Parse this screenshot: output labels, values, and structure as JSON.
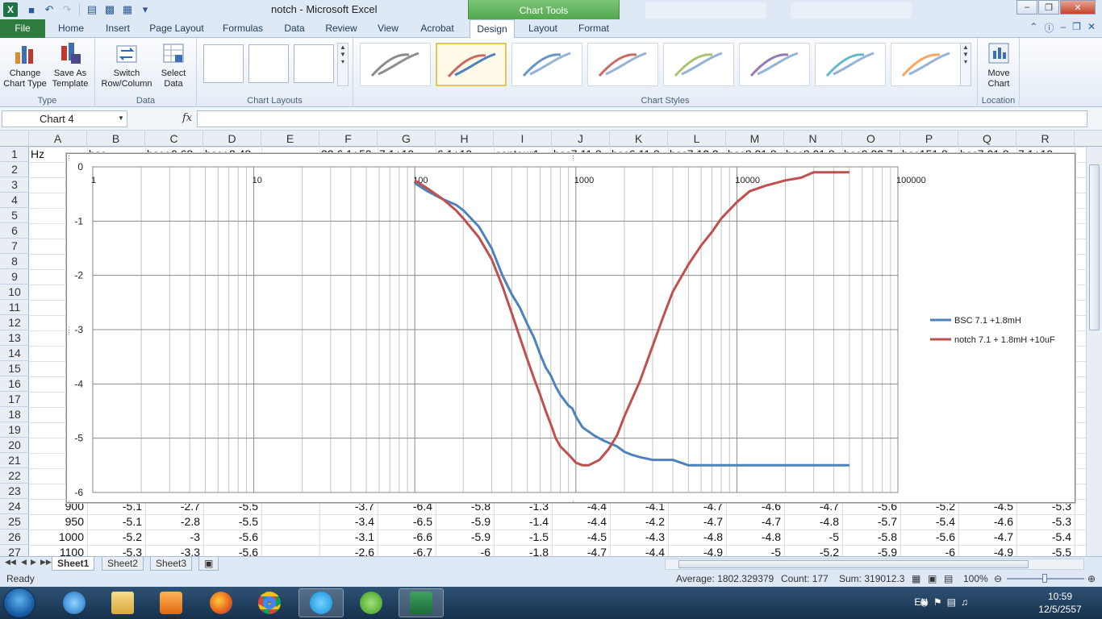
{
  "window": {
    "title": "notch  -  Microsoft Excel",
    "chart_tools_label": "Chart Tools"
  },
  "ribbon": {
    "tabs": [
      "Home",
      "Insert",
      "Page Layout",
      "Formulas",
      "Data",
      "Review",
      "View",
      "Acrobat",
      "Design",
      "Layout",
      "Format"
    ],
    "file_tab": "File",
    "active_tab": "Design",
    "groups": {
      "type": {
        "label": "Type",
        "change_chart_type": "Change Chart Type",
        "save_as_template": "Save As Template"
      },
      "data": {
        "label": "Data",
        "switch_row_column": "Switch Row/Column",
        "select_data": "Select Data"
      },
      "chart_layouts": {
        "label": "Chart Layouts"
      },
      "chart_styles": {
        "label": "Chart Styles",
        "style_colors": [
          "#555555",
          "#c0504d",
          "#4f81bd",
          "#c0504d",
          "#9bbb59",
          "#8064a2",
          "#4bacc6",
          "#f79646"
        ],
        "selected_index": 1
      },
      "location": {
        "label": "Location",
        "move_chart": "Move Chart"
      }
    }
  },
  "formula_bar": {
    "name_box": "Chart 4",
    "fx": "fx",
    "formula": ""
  },
  "columns": [
    "A",
    "B",
    "C",
    "D",
    "E",
    "F",
    "G",
    "H",
    "I",
    "J",
    "K",
    "L",
    "M",
    "N",
    "O",
    "P",
    "Q",
    "R"
  ],
  "rows": [
    "1",
    "2",
    "3",
    "4",
    "5",
    "6",
    "7",
    "8",
    "9",
    "10",
    "11",
    "12",
    "13",
    "14",
    "15",
    "16",
    "17",
    "18",
    "19",
    "20",
    "21",
    "22",
    "23",
    "24",
    "25",
    "26",
    "27"
  ],
  "cells": {
    "a1": "Hz",
    "row24": [
      "900",
      "-5.1",
      "-2.7",
      "-5.5",
      "",
      "-3.7",
      "-6.4",
      "-5.8",
      "-1.3",
      "-4.4",
      "-4.1",
      "-4.7",
      "-4.6",
      "-4.7",
      "-5.6",
      "-5.2",
      "-4.5",
      "-5.3"
    ],
    "row25": [
      "950",
      "-5.1",
      "-2.8",
      "-5.5",
      "",
      "-3.4",
      "-6.5",
      "-5.9",
      "-1.4",
      "-4.4",
      "-4.2",
      "-4.7",
      "-4.7",
      "-4.8",
      "-5.7",
      "-5.4",
      "-4.6",
      "-5.3"
    ],
    "row26": [
      "1000",
      "-5.2",
      "-3",
      "-5.6",
      "",
      "-3.1",
      "-6.6",
      "-5.9",
      "-1.5",
      "-4.5",
      "-4.3",
      "-4.8",
      "-4.8",
      "-5",
      "-5.8",
      "-5.6",
      "-4.7",
      "-5.4"
    ],
    "row27": [
      "1100",
      "-5.3",
      "-3.3",
      "-5.6",
      "",
      "-2.6",
      "-6.7",
      "-6",
      "-1.8",
      "-4.7",
      "-4.4",
      "-4.9",
      "-5",
      "-5.2",
      "-5.9",
      "-6",
      "-4.9",
      "-5.5"
    ],
    "row1_partial": [
      "bsc",
      "bsc+0.68",
      "bsc+2.48",
      "",
      "22.6.1+50",
      "7.1+10",
      "6.1+10",
      "contour1",
      "bsc7.11.8",
      "bsc6.11.8",
      "bsc7.12.2",
      "bsc8.21.8",
      "bsc8.01.8",
      "bsc9.22.7",
      "bsc151.8",
      "bsc7.01.8",
      "7.1+10"
    ]
  },
  "sheets": [
    "Sheet1",
    "Sheet2",
    "Sheet3"
  ],
  "active_sheet": "Sheet1",
  "status": {
    "ready": "Ready",
    "average": "Average: 1802.329379",
    "count": "Count: 177",
    "sum": "Sum: 319012.3",
    "zoom": "100%"
  },
  "taskbar": {
    "lang": "EN",
    "time": "10:59",
    "date": "12/5/2557"
  },
  "chart_data": {
    "type": "line",
    "xscale": "log",
    "xlim": [
      1,
      100000
    ],
    "ylim": [
      -6,
      0
    ],
    "x_ticks": [
      "1",
      "10",
      "100",
      "1000",
      "10000",
      "100000"
    ],
    "y_ticks": [
      "0",
      "-1",
      "-2",
      "-3",
      "-4",
      "-5",
      "-6"
    ],
    "legend_position": "right",
    "grid": true,
    "series": [
      {
        "name": "BSC 7.1 +1.8mH",
        "color": "#4f81bd",
        "x": [
          100,
          120,
          150,
          180,
          200,
          250,
          300,
          350,
          400,
          450,
          500,
          550,
          600,
          650,
          700,
          750,
          800,
          900,
          950,
          1000,
          1100,
          1300,
          1500,
          1800,
          2000,
          2200,
          2500,
          3000,
          3500,
          4000,
          5000,
          10000,
          20000,
          50000
        ],
        "y": [
          -0.3,
          -0.45,
          -0.6,
          -0.7,
          -0.8,
          -1.1,
          -1.5,
          -2.0,
          -2.35,
          -2.6,
          -2.9,
          -3.15,
          -3.45,
          -3.7,
          -3.85,
          -4.05,
          -4.2,
          -4.4,
          -4.45,
          -4.6,
          -4.8,
          -4.95,
          -5.05,
          -5.15,
          -5.25,
          -5.3,
          -5.35,
          -5.4,
          -5.4,
          -5.4,
          -5.5,
          -5.5,
          -5.5,
          -5.5
        ]
      },
      {
        "name": "notch 7.1 + 1.8mH +10uF",
        "color": "#c0504d",
        "x": [
          100,
          120,
          150,
          180,
          200,
          250,
          300,
          350,
          400,
          450,
          500,
          550,
          600,
          650,
          700,
          750,
          800,
          900,
          1000,
          1100,
          1200,
          1400,
          1600,
          1800,
          2000,
          2500,
          3000,
          3500,
          4000,
          5000,
          6000,
          7000,
          8000,
          10000,
          12000,
          15000,
          20000,
          25000,
          30000,
          50000
        ],
        "y": [
          -0.25,
          -0.4,
          -0.6,
          -0.8,
          -0.95,
          -1.3,
          -1.7,
          -2.2,
          -2.7,
          -3.15,
          -3.55,
          -3.9,
          -4.2,
          -4.5,
          -4.75,
          -5.0,
          -5.15,
          -5.3,
          -5.45,
          -5.5,
          -5.5,
          -5.4,
          -5.2,
          -4.95,
          -4.6,
          -3.95,
          -3.3,
          -2.75,
          -2.3,
          -1.8,
          -1.45,
          -1.2,
          -0.95,
          -0.65,
          -0.45,
          -0.35,
          -0.25,
          -0.2,
          -0.1,
          -0.1
        ]
      }
    ]
  }
}
